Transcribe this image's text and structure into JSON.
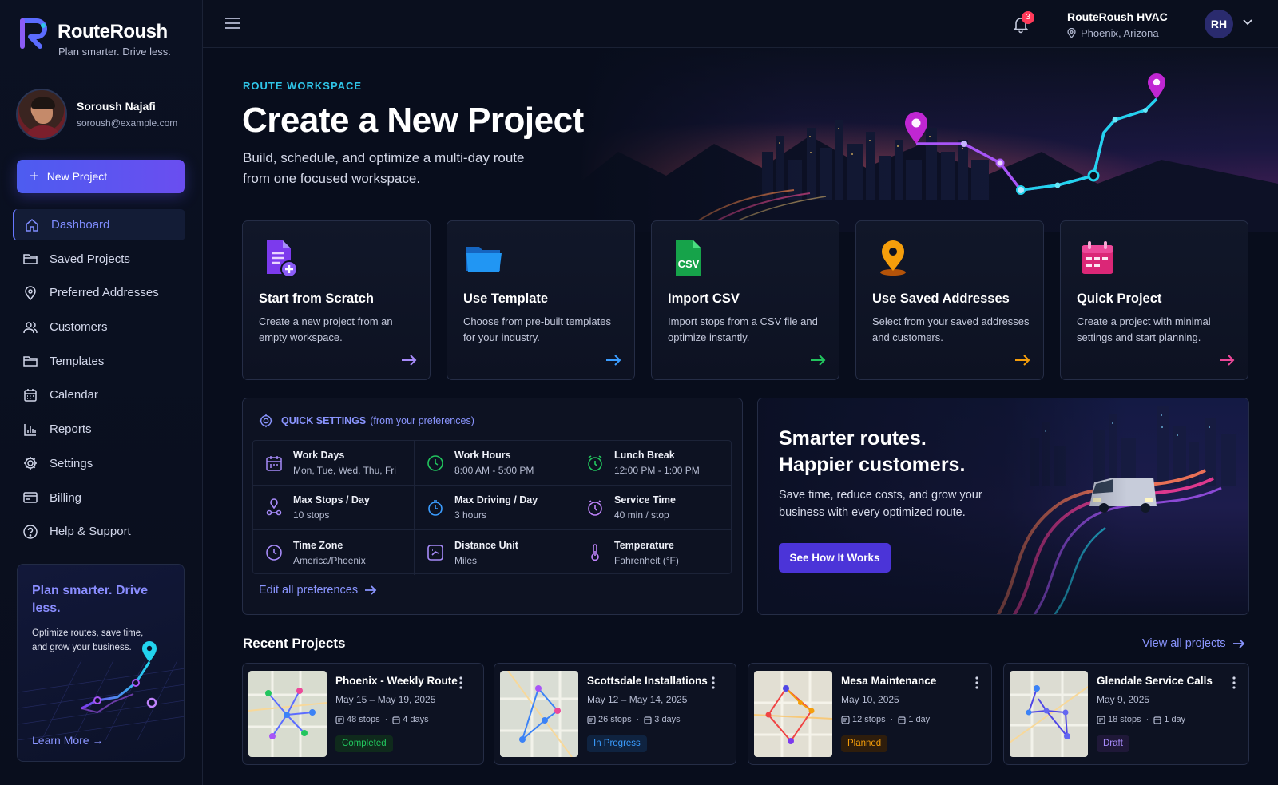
{
  "app": {
    "name": "RouteRoush",
    "tagline": "Plan smarter. Drive less."
  },
  "user": {
    "name": "Soroush Najafi",
    "email": "soroush@example.com",
    "initials": "RH"
  },
  "org": {
    "name": "RouteRoush HVAC",
    "location": "Phoenix, Arizona"
  },
  "notifications": {
    "count": "3"
  },
  "sidebar": {
    "new_project_label": "New Project",
    "items": [
      {
        "label": "Dashboard",
        "icon": "home-icon",
        "active": true
      },
      {
        "label": "Saved Projects",
        "icon": "folder-icon"
      },
      {
        "label": "Preferred Addresses",
        "icon": "map-pin-icon"
      },
      {
        "label": "Customers",
        "icon": "users-icon"
      },
      {
        "label": "Templates",
        "icon": "folder-icon"
      },
      {
        "label": "Calendar",
        "icon": "calendar-icon"
      },
      {
        "label": "Reports",
        "icon": "bar-chart-icon"
      },
      {
        "label": "Settings",
        "icon": "gear-icon"
      },
      {
        "label": "Billing",
        "icon": "credit-card-icon"
      },
      {
        "label": "Help & Support",
        "icon": "help-circle-icon"
      }
    ],
    "promo": {
      "title": "Plan smarter. Drive less.",
      "text": "Optimize routes, save time, and grow your business.",
      "link": "Learn More"
    }
  },
  "hero": {
    "eyebrow": "ROUTE WORKSPACE",
    "title": "Create a New Project",
    "subtitle": "Build, schedule, and optimize a multi-day route from one focused workspace."
  },
  "options": [
    {
      "title": "Start from Scratch",
      "desc": "Create a new project from an empty workspace.",
      "icon": "document-plus-icon",
      "color": "#8b5cf6"
    },
    {
      "title": "Use Template",
      "desc": "Choose from pre-built templates for your industry.",
      "icon": "folder-icon",
      "color": "#2196f3"
    },
    {
      "title": "Import CSV",
      "desc": "Import stops from a CSV file and optimize instantly.",
      "icon": "csv-file-icon",
      "color": "#22c55e"
    },
    {
      "title": "Use Saved Addresses",
      "desc": "Select from your saved addresses and customers.",
      "icon": "map-pin-icon",
      "color": "#f59e0b"
    },
    {
      "title": "Quick Project",
      "desc": "Create a project with minimal settings and start planning.",
      "icon": "calendar-icon",
      "color": "#ec4899"
    }
  ],
  "quick_settings": {
    "title": "QUICK SETTINGS",
    "note": "(from your preferences)",
    "items": [
      {
        "label": "Work Days",
        "value": "Mon, Tue, Wed, Thu, Fri",
        "icon": "calendar-icon"
      },
      {
        "label": "Work Hours",
        "value": "8:00 AM  -  5:00 PM",
        "icon": "clock-icon"
      },
      {
        "label": "Lunch Break",
        "value": "12:00 PM  -  1:00 PM",
        "icon": "alarm-clock-icon"
      },
      {
        "label": "Max Stops / Day",
        "value": "10 stops",
        "icon": "route-icon"
      },
      {
        "label": "Max Driving / Day",
        "value": "3 hours",
        "icon": "timer-icon"
      },
      {
        "label": "Service Time",
        "value": "40 min / stop",
        "icon": "alarm-clock-icon"
      },
      {
        "label": "Time Zone",
        "value": "America/Phoenix",
        "icon": "clock-icon"
      },
      {
        "label": "Distance Unit",
        "value": "Miles",
        "icon": "distance-icon"
      },
      {
        "label": "Temperature",
        "value": "Fahrenheit (°F)",
        "icon": "thermometer-icon"
      }
    ],
    "edit_link": "Edit all preferences"
  },
  "banner": {
    "title": "Smarter routes. Happier customers.",
    "text": "Save time, reduce costs, and grow your business with every optimized route.",
    "button": "See How It Works"
  },
  "recent": {
    "title": "Recent Projects",
    "view_all": "View all projects",
    "projects": [
      {
        "name": "Phoenix - Weekly Route",
        "dates": "May 15 – May 19, 2025",
        "stops": "48 stops",
        "days": "4 days",
        "status": "Completed",
        "status_color": "#22c55e"
      },
      {
        "name": "Scottsdale Installations",
        "dates": "May 12 – May 14, 2025",
        "stops": "26 stops",
        "days": "3 days",
        "status": "In Progress",
        "status_color": "#3b9dff"
      },
      {
        "name": "Mesa Maintenance",
        "dates": "May 10, 2025",
        "stops": "12 stops",
        "days": "1 day",
        "status": "Planned",
        "status_color": "#f59e0b"
      },
      {
        "name": "Glendale Service Calls",
        "dates": "May 9, 2025",
        "stops": "18 stops",
        "days": "1 day",
        "status": "Draft",
        "status_color": "#a78bfa"
      }
    ]
  }
}
